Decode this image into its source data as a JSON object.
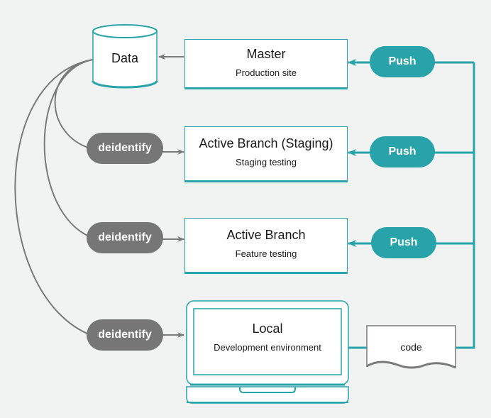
{
  "colors": {
    "accent": "#27a3a9",
    "neutral": "#767676",
    "background": "#f1f3f2",
    "connector": "#7a7a7a"
  },
  "data_store": {
    "label": "Data"
  },
  "environments": [
    {
      "title": "Master",
      "subtitle": "Production site"
    },
    {
      "title": "Active Branch (Staging)",
      "subtitle": "Staging testing"
    },
    {
      "title": "Active Branch",
      "subtitle": "Feature testing"
    },
    {
      "title": "Local",
      "subtitle": "Development environment"
    }
  ],
  "push_buttons": [
    {
      "label": "Push"
    },
    {
      "label": "Push"
    },
    {
      "label": "Push"
    }
  ],
  "deidentify_steps": [
    {
      "label": "deidentify"
    },
    {
      "label": "deidentify"
    },
    {
      "label": "deidentify"
    }
  ],
  "code_document": {
    "label": "code"
  }
}
